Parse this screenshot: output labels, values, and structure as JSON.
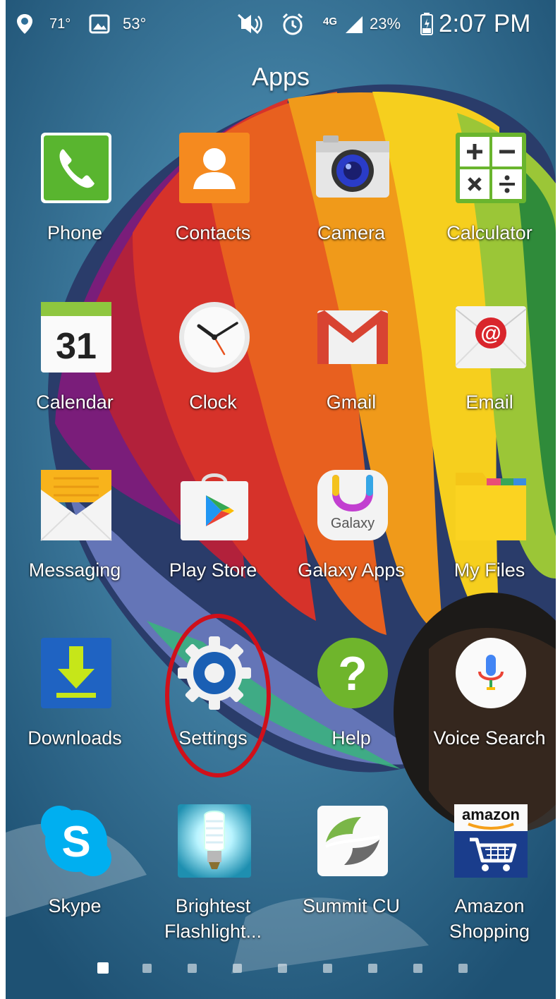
{
  "status_bar": {
    "temp1": "71°",
    "temp2": "53°",
    "network": "4G",
    "battery": "23%",
    "time": "2:07 PM"
  },
  "title": "Apps",
  "apps": [
    {
      "label": "Phone",
      "icon": "phone-icon"
    },
    {
      "label": "Contacts",
      "icon": "contacts-icon"
    },
    {
      "label": "Camera",
      "icon": "camera-icon"
    },
    {
      "label": "Calculator",
      "icon": "calculator-icon"
    },
    {
      "label": "Calendar",
      "icon": "calendar-icon",
      "icon_text": "31"
    },
    {
      "label": "Clock",
      "icon": "clock-icon"
    },
    {
      "label": "Gmail",
      "icon": "gmail-icon"
    },
    {
      "label": "Email",
      "icon": "email-icon",
      "icon_text": "@"
    },
    {
      "label": "Messaging",
      "icon": "messaging-icon"
    },
    {
      "label": "Play Store",
      "icon": "play-store-icon"
    },
    {
      "label": "Galaxy Apps",
      "icon": "galaxy-apps-icon",
      "icon_text": "Galaxy"
    },
    {
      "label": "My Files",
      "icon": "my-files-icon"
    },
    {
      "label": "Downloads",
      "icon": "downloads-icon"
    },
    {
      "label": "Settings",
      "icon": "settings-icon"
    },
    {
      "label": "Help",
      "icon": "help-icon",
      "icon_text": "?"
    },
    {
      "label": "Voice Search",
      "icon": "voice-search-icon"
    },
    {
      "label": "Skype",
      "icon": "skype-icon",
      "icon_text": "S"
    },
    {
      "label": "Brightest\nFlashlight...",
      "icon": "flashlight-icon"
    },
    {
      "label": "Summit CU",
      "icon": "summit-cu-icon"
    },
    {
      "label": "Amazon\nShopping",
      "icon": "amazon-shopping-icon",
      "icon_text": "amazon"
    }
  ],
  "page_indicator": {
    "count": 9,
    "active": 0
  },
  "highlight_color": "#d0101a"
}
